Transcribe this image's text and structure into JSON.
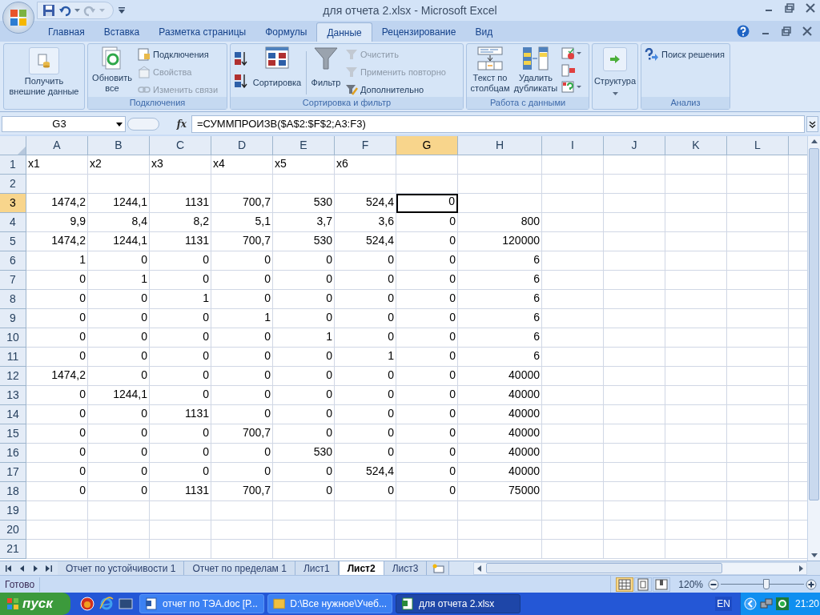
{
  "window": {
    "title": "для отчета 2.xlsx - Microsoft Excel"
  },
  "ribbon": {
    "tabs": [
      {
        "label": "Главная",
        "selected": false
      },
      {
        "label": "Вставка",
        "selected": false
      },
      {
        "label": "Разметка страницы",
        "selected": false
      },
      {
        "label": "Формулы",
        "selected": false
      },
      {
        "label": "Данные",
        "selected": true
      },
      {
        "label": "Рецензирование",
        "selected": false
      },
      {
        "label": "Вид",
        "selected": false
      }
    ],
    "groups": [
      {
        "buttons": [
          {
            "label": "Получить внешние данные",
            "disabled": false
          }
        ]
      },
      {
        "label": "Подключения",
        "buttons": [
          {
            "label": "Обновить все",
            "disabled": false
          },
          {
            "label": "Подключения",
            "disabled": false
          },
          {
            "label": "Свойства",
            "disabled": true
          },
          {
            "label": "Изменить связи",
            "disabled": true
          }
        ]
      },
      {
        "label": "Сортировка и фильтр",
        "buttons": [
          {
            "label": "Сортировка",
            "disabled": false
          },
          {
            "label": "Фильтр",
            "disabled": false
          },
          {
            "label": "Очистить",
            "disabled": true
          },
          {
            "label": "Применить повторно",
            "disabled": true
          },
          {
            "label": "Дополнительно",
            "disabled": false
          }
        ]
      },
      {
        "label": "Работа с данными",
        "buttons": [
          {
            "label": "Текст по столбцам",
            "disabled": false
          },
          {
            "label": "Удалить дубликаты",
            "disabled": false
          }
        ]
      },
      {
        "buttons": [
          {
            "label": "Структура",
            "disabled": false
          }
        ]
      },
      {
        "label": "Анализ",
        "buttons": [
          {
            "label": "Поиск решения",
            "disabled": false
          }
        ]
      }
    ]
  },
  "formula_bar": {
    "name_box": "G3",
    "function_label": "fx",
    "formula": "=СУММПРОИЗВ($A$2:$F$2;A3:F3)"
  },
  "sheet": {
    "columns": [
      {
        "label": "A",
        "selected": false
      },
      {
        "label": "B",
        "selected": false
      },
      {
        "label": "C",
        "selected": false
      },
      {
        "label": "D",
        "selected": false
      },
      {
        "label": "E",
        "selected": false
      },
      {
        "label": "F",
        "selected": false
      },
      {
        "label": "G",
        "selected": true
      },
      {
        "label": "H",
        "selected": false
      },
      {
        "label": "I",
        "selected": false
      },
      {
        "label": "J",
        "selected": false
      },
      {
        "label": "K",
        "selected": false
      },
      {
        "label": "L",
        "selected": false
      }
    ],
    "rows": [
      {
        "header": "1",
        "selected": false,
        "cells": [
          "x1",
          "x2",
          "x3",
          "x4",
          "x5",
          "x6"
        ]
      },
      {
        "header": "2",
        "selected": false
      },
      {
        "header": "3",
        "selected": true,
        "cells": [
          "1474,2",
          "1244,1",
          "1131",
          "700,7",
          "530",
          "524,4",
          "0"
        ]
      },
      {
        "header": "4",
        "selected": false,
        "cells": [
          "9,9",
          "8,4",
          "8,2",
          "5,1",
          "3,7",
          "3,6",
          "0",
          "800"
        ]
      },
      {
        "header": "5",
        "selected": false,
        "cells": [
          "1474,2",
          "1244,1",
          "1131",
          "700,7",
          "530",
          "524,4",
          "0",
          "120000"
        ]
      },
      {
        "header": "6",
        "selected": false,
        "cells": [
          "1",
          "0",
          "0",
          "0",
          "0",
          "0",
          "0",
          "6"
        ]
      },
      {
        "header": "7",
        "selected": false,
        "cells": [
          "0",
          "1",
          "0",
          "0",
          "0",
          "0",
          "0",
          "6"
        ]
      },
      {
        "header": "8",
        "selected": false,
        "cells": [
          "0",
          "0",
          "1",
          "0",
          "0",
          "0",
          "0",
          "6"
        ]
      },
      {
        "header": "9",
        "selected": false,
        "cells": [
          "0",
          "0",
          "0",
          "1",
          "0",
          "0",
          "0",
          "6"
        ]
      },
      {
        "header": "10",
        "selected": false,
        "cells": [
          "0",
          "0",
          "0",
          "0",
          "1",
          "0",
          "0",
          "6"
        ]
      },
      {
        "header": "11",
        "selected": false,
        "cells": [
          "0",
          "0",
          "0",
          "0",
          "0",
          "1",
          "0",
          "6"
        ]
      },
      {
        "header": "12",
        "selected": false,
        "cells": [
          "1474,2",
          "0",
          "0",
          "0",
          "0",
          "0",
          "0",
          "40000"
        ]
      },
      {
        "header": "13",
        "selected": false,
        "cells": [
          "0",
          "1244,1",
          "0",
          "0",
          "0",
          "0",
          "0",
          "40000"
        ]
      },
      {
        "header": "14",
        "selected": false,
        "cells": [
          "0",
          "0",
          "1131",
          "0",
          "0",
          "0",
          "0",
          "40000"
        ]
      },
      {
        "header": "15",
        "selected": false,
        "cells": [
          "0",
          "0",
          "0",
          "700,7",
          "0",
          "0",
          "0",
          "40000"
        ]
      },
      {
        "header": "16",
        "selected": false,
        "cells": [
          "0",
          "0",
          "0",
          "0",
          "530",
          "0",
          "0",
          "40000"
        ]
      },
      {
        "header": "17",
        "selected": false,
        "cells": [
          "0",
          "0",
          "0",
          "0",
          "0",
          "524,4",
          "0",
          "40000"
        ]
      },
      {
        "header": "18",
        "selected": false,
        "cells": [
          "0",
          "0",
          "1131",
          "700,7",
          "0",
          "0",
          "0",
          "75000"
        ]
      },
      {
        "header": "19",
        "selected": false
      },
      {
        "header": "20",
        "selected": false
      },
      {
        "header": "21",
        "selected": false
      }
    ]
  },
  "sheet_tabs": [
    {
      "label": "Отчет по устойчивости 1",
      "selected": false
    },
    {
      "label": "Отчет по пределам 1",
      "selected": false
    },
    {
      "label": "Лист1",
      "selected": false
    },
    {
      "label": "Лист2",
      "selected": true
    },
    {
      "label": "Лист3",
      "selected": false
    }
  ],
  "status_bar": {
    "text": "Готово",
    "views": [
      {
        "selected": true
      },
      {
        "selected": false
      },
      {
        "selected": false
      }
    ],
    "zoom": "120%",
    "zoom_slider": {
      "level": 0.55
    }
  },
  "taskbar": {
    "start": "пуск",
    "tasks": [
      {
        "label": "отчет по ТЭА.doc [Р...",
        "selected": false
      },
      {
        "label": "D:\\Все нужное\\Учеб...",
        "selected": false
      },
      {
        "label": "для отчета 2.xlsx",
        "selected": true
      }
    ],
    "language": "EN",
    "clock": "21:20"
  }
}
